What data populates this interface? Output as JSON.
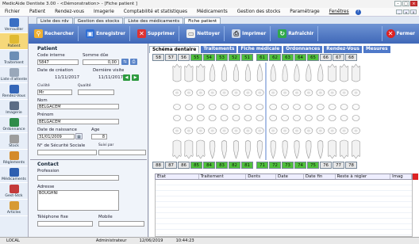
{
  "window": {
    "title": "MedicAide Dentiste 3.00 - <Démonstration> - [Fiche patient ]",
    "controls": [
      "min",
      "max",
      "close"
    ]
  },
  "menu": [
    {
      "label": "Fichier"
    },
    {
      "label": "Patient"
    },
    {
      "label": "Rendez-vous"
    },
    {
      "label": "Imagerie"
    },
    {
      "label": "Comptabilité et statistiques"
    },
    {
      "label": "Médicaments"
    },
    {
      "label": "Gestion des stocks"
    },
    {
      "label": "Paramétrage"
    },
    {
      "label": "Fenêtres"
    }
  ],
  "left_nav": [
    {
      "label": "Verrouiller",
      "color": "#3a6fc4"
    },
    {
      "label": "Patient",
      "color": "#e0ba32",
      "selected": true
    },
    {
      "label": "Traitement",
      "color": "#6d8fb6"
    },
    {
      "label": "Liste d'attente",
      "color": "#9aa8ba"
    },
    {
      "label": "Rendez-Vous",
      "color": "#3466b8"
    },
    {
      "label": "Imagerie",
      "color": "#5b6d86"
    },
    {
      "label": "Ordonnance",
      "color": "#2f8c4a"
    },
    {
      "label": "Stock",
      "color": "#9d9d9d"
    },
    {
      "label": "Règlements",
      "color": "#d48a2a"
    },
    {
      "label": "Médicaments",
      "color": "#2e5fb0"
    },
    {
      "label": "Gest-Stck",
      "color": "#c43a3a"
    },
    {
      "label": "Articles",
      "color": "#d79a34"
    }
  ],
  "doc_tabs": [
    {
      "label": "Liste des rdv"
    },
    {
      "label": "Gestion des stocks"
    },
    {
      "label": "Liste des médicaments"
    },
    {
      "label": "Fiche patient",
      "active": true
    }
  ],
  "toolbar": {
    "search": "Rechercher",
    "save": "Enregistrer",
    "delete": "Supprimer",
    "clear": "Nettoyer",
    "print": "Imprimer",
    "refresh": "Rafraîchir",
    "close": "Fermer"
  },
  "patient": {
    "section": "Patient",
    "code_label": "Code interne",
    "code_value": "5847",
    "balance_label": "Somme dûe",
    "balance_value": "0,00",
    "created_label": "Date de création",
    "created_value": "11/11/2017",
    "last_visit_label": "Dernière visite",
    "last_visit_value": "11/11/2017",
    "civility_label": "Civilité",
    "civility_value": "Mr",
    "quality_label": "Qualité",
    "quality_value": "",
    "lastname_label": "Nom",
    "lastname_value": "BELGACEM",
    "firstname_label": "Prénom",
    "firstname_value": "BELGACEM",
    "birth_label": "Date de naissance",
    "birth_value": "31/01/2009",
    "age_label": "Age",
    "age_value": "8",
    "ssn_label": "N° de Sécurité Sociale",
    "ssn_value": "",
    "followed_label": "Suivi par",
    "followed_value": ""
  },
  "contact": {
    "section": "Contact",
    "profession_label": "Profession",
    "profession_value": "",
    "address_label": "Adresse",
    "address_value": "BOUGHNI",
    "phone_label": "Téléphone fixe",
    "phone_value": "",
    "mobile_label": "Mobile",
    "mobile_value": ""
  },
  "main_tabs": [
    {
      "label": "Schéma dentaire",
      "active": true
    },
    {
      "label": "Traitements"
    },
    {
      "label": "Fiche médicale"
    },
    {
      "label": "Ordonnances"
    },
    {
      "label": "Rendez-Vous"
    },
    {
      "label": "Mesures"
    }
  ],
  "upper_teeth": [
    {
      "n": "58",
      "g": false
    },
    {
      "n": "57",
      "g": false
    },
    {
      "n": "56",
      "g": false
    },
    {
      "n": "55",
      "g": true
    },
    {
      "n": "54",
      "g": true
    },
    {
      "n": "53",
      "g": true
    },
    {
      "n": "52",
      "g": true
    },
    {
      "n": "51",
      "g": true
    },
    {
      "n": "61",
      "g": true
    },
    {
      "n": "62",
      "g": true
    },
    {
      "n": "63",
      "g": true
    },
    {
      "n": "64",
      "g": true
    },
    {
      "n": "65",
      "g": true
    },
    {
      "n": "66",
      "g": false
    },
    {
      "n": "67",
      "g": false
    },
    {
      "n": "68",
      "g": false
    }
  ],
  "lower_teeth": [
    {
      "n": "88",
      "g": false
    },
    {
      "n": "87",
      "g": false
    },
    {
      "n": "86",
      "g": false
    },
    {
      "n": "85",
      "g": true
    },
    {
      "n": "84",
      "g": true
    },
    {
      "n": "83",
      "g": true
    },
    {
      "n": "82",
      "g": true
    },
    {
      "n": "81",
      "g": true
    },
    {
      "n": "71",
      "g": true
    },
    {
      "n": "72",
      "g": true
    },
    {
      "n": "73",
      "g": true
    },
    {
      "n": "74",
      "g": true
    },
    {
      "n": "75",
      "g": true
    },
    {
      "n": "76",
      "g": false
    },
    {
      "n": "77",
      "g": false
    },
    {
      "n": "78",
      "g": false
    }
  ],
  "grid_columns": [
    {
      "label": "Etat"
    },
    {
      "label": "Traitement"
    },
    {
      "label": "Dents"
    },
    {
      "label": "Date"
    },
    {
      "label": "Date fin"
    },
    {
      "label": "Reste à régler"
    },
    {
      "label": "Imag"
    }
  ],
  "status": {
    "mode": "LOCAL",
    "user": "Administrateur",
    "date": "12/06/2019",
    "time": "10:44:23"
  }
}
